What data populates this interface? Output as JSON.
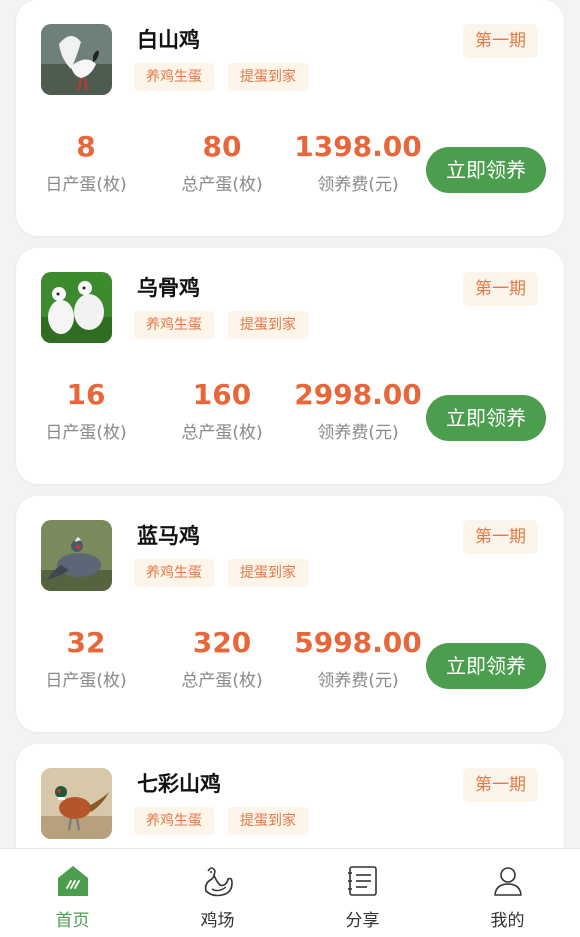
{
  "colors": {
    "accent_green": "#4a9e4e",
    "price_orange": "#e8673a",
    "tag_bg": "#fdf4ea"
  },
  "products": [
    {
      "name": "白山鸡",
      "tags": [
        "养鸡生蛋",
        "提蛋到家"
      ],
      "period": "第一期",
      "daily": "8",
      "daily_label": "日产蛋(枚)",
      "total": "80",
      "total_label": "总产蛋(枚)",
      "fee": "1398.00",
      "fee_label": "领养费(元)",
      "button": "立即领养",
      "thumb_icon": "white-pheasant-photo"
    },
    {
      "name": "乌骨鸡",
      "tags": [
        "养鸡生蛋",
        "提蛋到家"
      ],
      "period": "第一期",
      "daily": "16",
      "daily_label": "日产蛋(枚)",
      "total": "160",
      "total_label": "总产蛋(枚)",
      "fee": "2998.00",
      "fee_label": "领养费(元)",
      "button": "立即领养",
      "thumb_icon": "silkie-chicken-photo"
    },
    {
      "name": "蓝马鸡",
      "tags": [
        "养鸡生蛋",
        "提蛋到家"
      ],
      "period": "第一期",
      "daily": "32",
      "daily_label": "日产蛋(枚)",
      "total": "320",
      "total_label": "总产蛋(枚)",
      "fee": "5998.00",
      "fee_label": "领养费(元)",
      "button": "立即领养",
      "thumb_icon": "blue-eared-pheasant-photo"
    },
    {
      "name": "七彩山鸡",
      "tags": [
        "养鸡生蛋",
        "提蛋到家"
      ],
      "period": "第一期",
      "thumb_icon": "ring-necked-pheasant-photo"
    }
  ],
  "tabbar": [
    {
      "label": "首页",
      "icon": "home-icon",
      "active": true
    },
    {
      "label": "鸡场",
      "icon": "chicken-farm-icon",
      "active": false
    },
    {
      "label": "分享",
      "icon": "share-list-icon",
      "active": false
    },
    {
      "label": "我的",
      "icon": "user-profile-icon",
      "active": false
    }
  ]
}
